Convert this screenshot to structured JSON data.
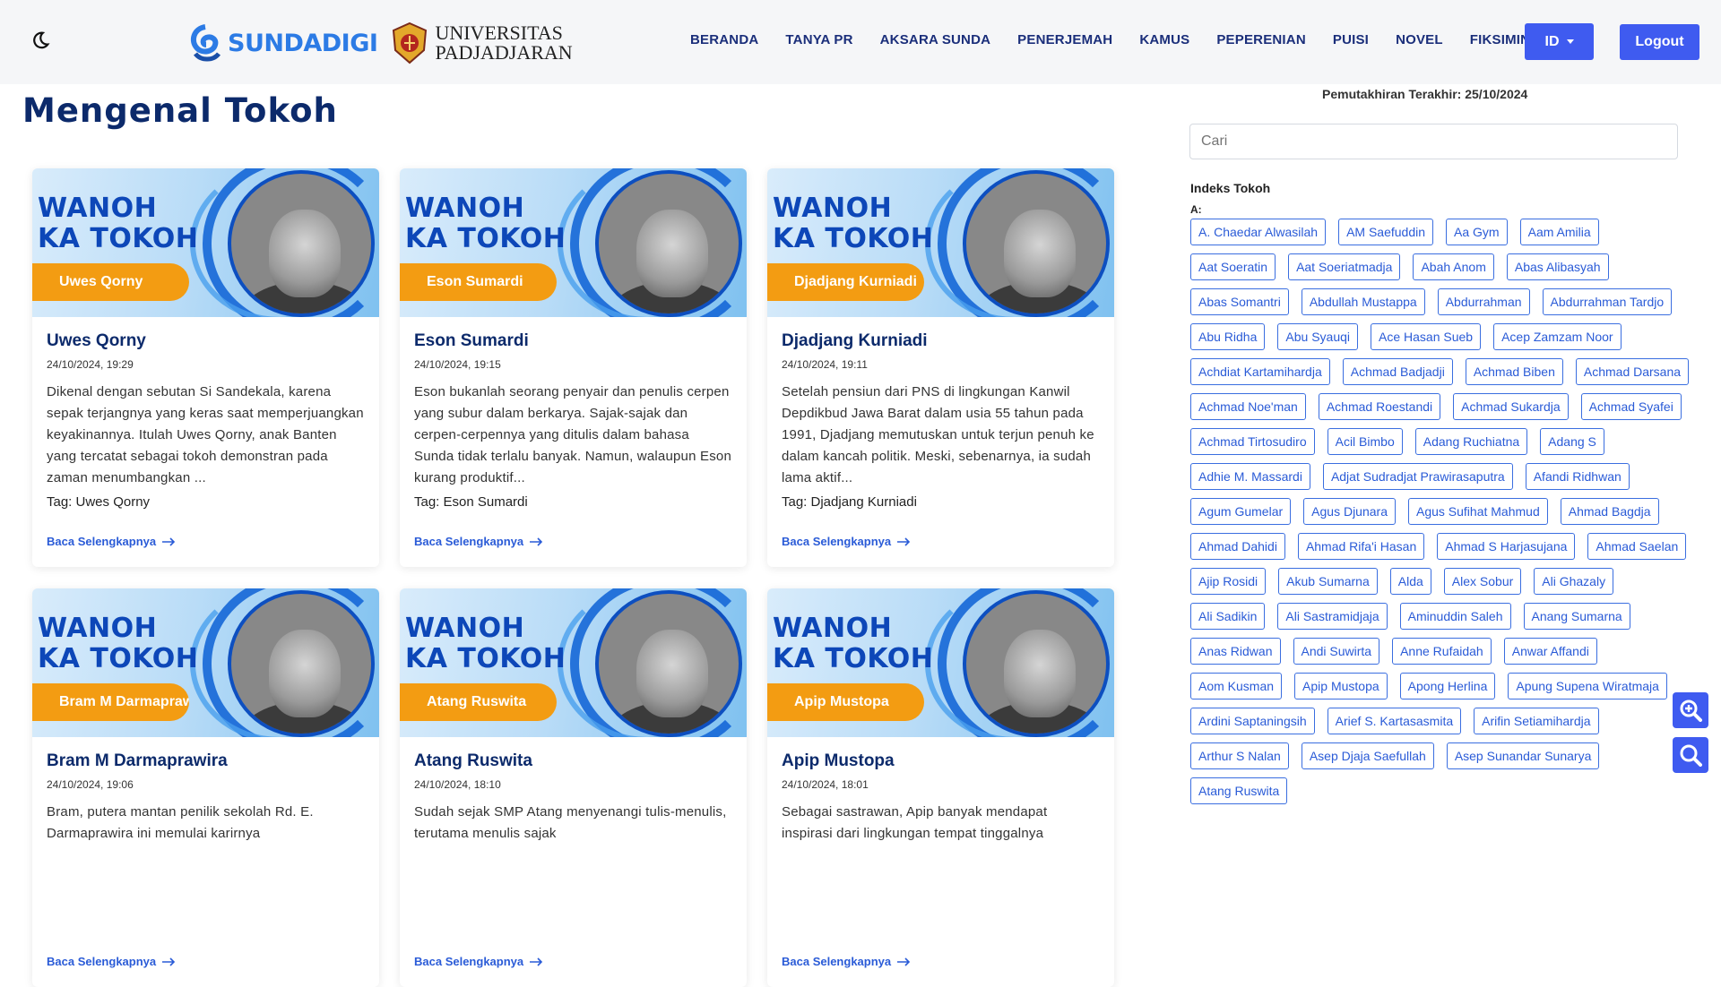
{
  "header": {
    "brand_sundadigi": "SUNDADIGI",
    "brand_unpad_line1": "UNIVERSITAS",
    "brand_unpad_line2": "PADJADJARAN",
    "menu": [
      "BERANDA",
      "TANYA PR",
      "AKSARA SUNDA",
      "PENERJEMAH",
      "KAMUS",
      "PEPERENIAN",
      "PUISI",
      "NOVEL",
      "FIKSIMINI"
    ],
    "lang_label": "ID",
    "logout_label": "Logout"
  },
  "main": {
    "title": "Mengenal Tokoh",
    "banner_text_line1": "WANOH",
    "banner_text_line2": "KA TOKOH",
    "read_more": "Baca Selengkapnya",
    "cards": [
      {
        "name": "Uwes Qorny",
        "date": "24/10/2024, 19:29",
        "excerpt": "Dikenal dengan sebutan Si Sandekala, karena sepak terjangnya yang keras saat memperjuangkan keyakinannya. Itulah Uwes Qorny, anak Banten yang tercatat sebagai tokoh demonstran pada zaman menumbangkan ...",
        "tag": "Tag: Uwes Qorny"
      },
      {
        "name": "Eson Sumardi",
        "date": "24/10/2024, 19:15",
        "excerpt": "Eson bukanlah seorang penyair dan penulis cerpen yang subur dalam berkarya. Sajak-sajak dan cerpen-cerpennya yang ditulis dalam bahasa Sunda tidak terlalu banyak. Namun, walaupun Eson kurang produktif...",
        "tag": "Tag: Eson Sumardi"
      },
      {
        "name": "Djadjang Kurniadi",
        "date": "24/10/2024, 19:11",
        "excerpt": "Setelah pensiun dari PNS di lingkungan Kanwil Depdikbud Jawa Barat dalam usia 55 tahun pada 1991, Djadjang memutuskan untuk terjun penuh ke dalam kancah politik. Meski, sebenarnya, ia sudah lama aktif...",
        "tag": "Tag: Djadjang Kurniadi"
      },
      {
        "name": "Bram M Darmaprawira",
        "date": "24/10/2024, 19:06",
        "excerpt": "Bram, putera mantan penilik sekolah Rd. E. Darmaprawira ini memulai karirnya",
        "tag": ""
      },
      {
        "name": "Atang Ruswita",
        "date": "24/10/2024, 18:10",
        "excerpt": "Sudah sejak SMP Atang menyenangi tulis-menulis, terutama menulis sajak",
        "tag": ""
      },
      {
        "name": "Apip Mustopa",
        "date": "24/10/2024, 18:01",
        "excerpt": "Sebagai sastrawan, Apip banyak mendapat inspirasi dari lingkungan tempat tinggalnya",
        "tag": ""
      }
    ]
  },
  "sidebar": {
    "last_update": "Pemutakhiran Terakhir: 25/10/2024",
    "search_placeholder": "Cari",
    "index_title": "Indeks Tokoh",
    "letter": "A:",
    "tags": [
      "A. Chaedar Alwasilah",
      "AM Saefuddin",
      "Aa Gym",
      "Aam Amilia",
      "Aat Soeratin",
      "Aat Soeriatmadja",
      "Abah Anom",
      "Abas Alibasyah",
      "Abas Somantri",
      "Abdullah Mustappa",
      "Abdurrahman",
      "Abdurrahman Tardjo",
      "Abu Ridha",
      "Abu Syauqi",
      "Ace Hasan Sueb",
      "Acep Zamzam Noor",
      "Achdiat Kartamihardja",
      "Achmad Badjadji",
      "Achmad Biben",
      "Achmad Darsana",
      "Achmad Noe'man",
      "Achmad Roestandi",
      "Achmad Sukardja",
      "Achmad Syafei",
      "Achmad Tirtosudiro",
      "Acil Bimbo",
      "Adang Ruchiatna",
      "Adang S",
      "Adhie M. Massardi",
      "Adjat Sudradjat Prawirasaputra",
      "Afandi Ridhwan",
      "Agum Gumelar",
      "Agus Djunara",
      "Agus Sufihat Mahmud",
      "Ahmad Bagdja",
      "Ahmad Dahidi",
      "Ahmad Rifa'i Hasan",
      "Ahmad S Harjasujana",
      "Ahmad Saelan",
      "Ajip Rosidi",
      "Akub Sumarna",
      "Alda",
      "Alex Sobur",
      "Ali Ghazaly",
      "Ali Sadikin",
      "Ali Sastramidjaja",
      "Aminuddin Saleh",
      "Anang Sumarna",
      "Anas Ridwan",
      "Andi Suwirta",
      "Anne Rufaidah",
      "Anwar Affandi",
      "Aom Kusman",
      "Apip Mustopa",
      "Apong Herlina",
      "Apung Supena Wiratmaja",
      "Ardini Saptaningsih",
      "Arief S. Kartasasmita",
      "Arifin Setiamihardja",
      "Arthur S Nalan",
      "Asep Djaja Saefullah",
      "Asep Sunandar Sunarya",
      "Atang Ruswita"
    ]
  }
}
